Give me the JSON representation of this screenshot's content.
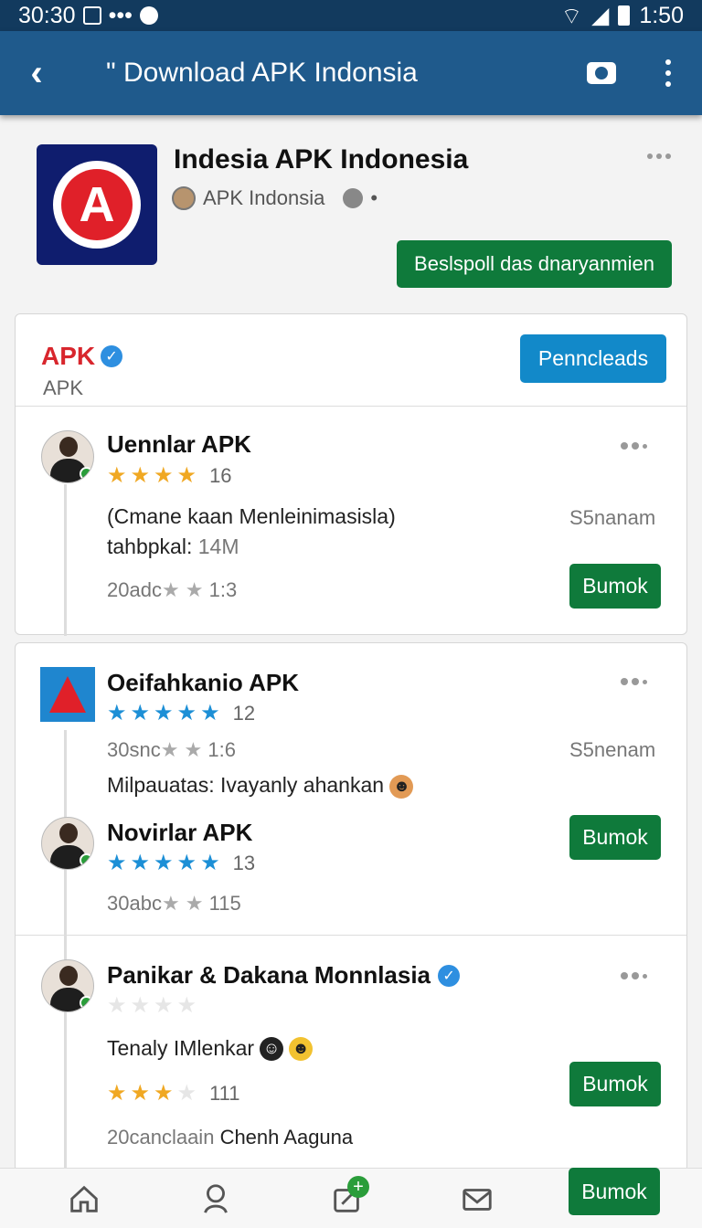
{
  "status_bar": {
    "left_time": "30:30",
    "right_time": "1:50"
  },
  "app_bar": {
    "title": "\" Download APK Indonsia"
  },
  "hero": {
    "title": "Indesia APK Indonesia",
    "publisher": "APK Indonsia",
    "cta_label": "Beslspoll das dnaryanmien"
  },
  "card_header": {
    "brand": "APK",
    "sub": "APK",
    "button": "Penncleads"
  },
  "items": [
    {
      "title": "Uennlar APK",
      "rating_count": "16",
      "desc": "(Cmane kaan Menleinimasisla)",
      "size_label": "tahbpkal:",
      "size_value": "14M",
      "status": "S5nanam",
      "meta_prefix": "20adc",
      "meta_value": "1:3",
      "button": "Bumok"
    },
    {
      "title": "Oeifahkanio APK",
      "rating_count": "12",
      "meta_prefix": "30snc",
      "meta_value": "1:6",
      "status": "S5nenam",
      "desc": "Milpauatas: Ivayanly ahankan"
    },
    {
      "title": "Novirlar APK",
      "rating_count": "13",
      "meta_prefix": "30abc",
      "meta_value": "115",
      "button": "Bumok"
    },
    {
      "title": "Panikar & Dakana Monnlasia",
      "desc": "Tenaly IMlenkar",
      "rating_count": "111",
      "meta_prefix": "20canclaain",
      "meta_value": "Chenh Aaguna",
      "button": "Bumok"
    }
  ],
  "bottom_nav": {
    "fab_label": "Bumok"
  },
  "colors": {
    "primary": "#1f5a8c",
    "status_bar": "#123a5e",
    "green": "#0f7a3b",
    "blue_button": "#1289c9",
    "brand_red": "#d8262d"
  }
}
